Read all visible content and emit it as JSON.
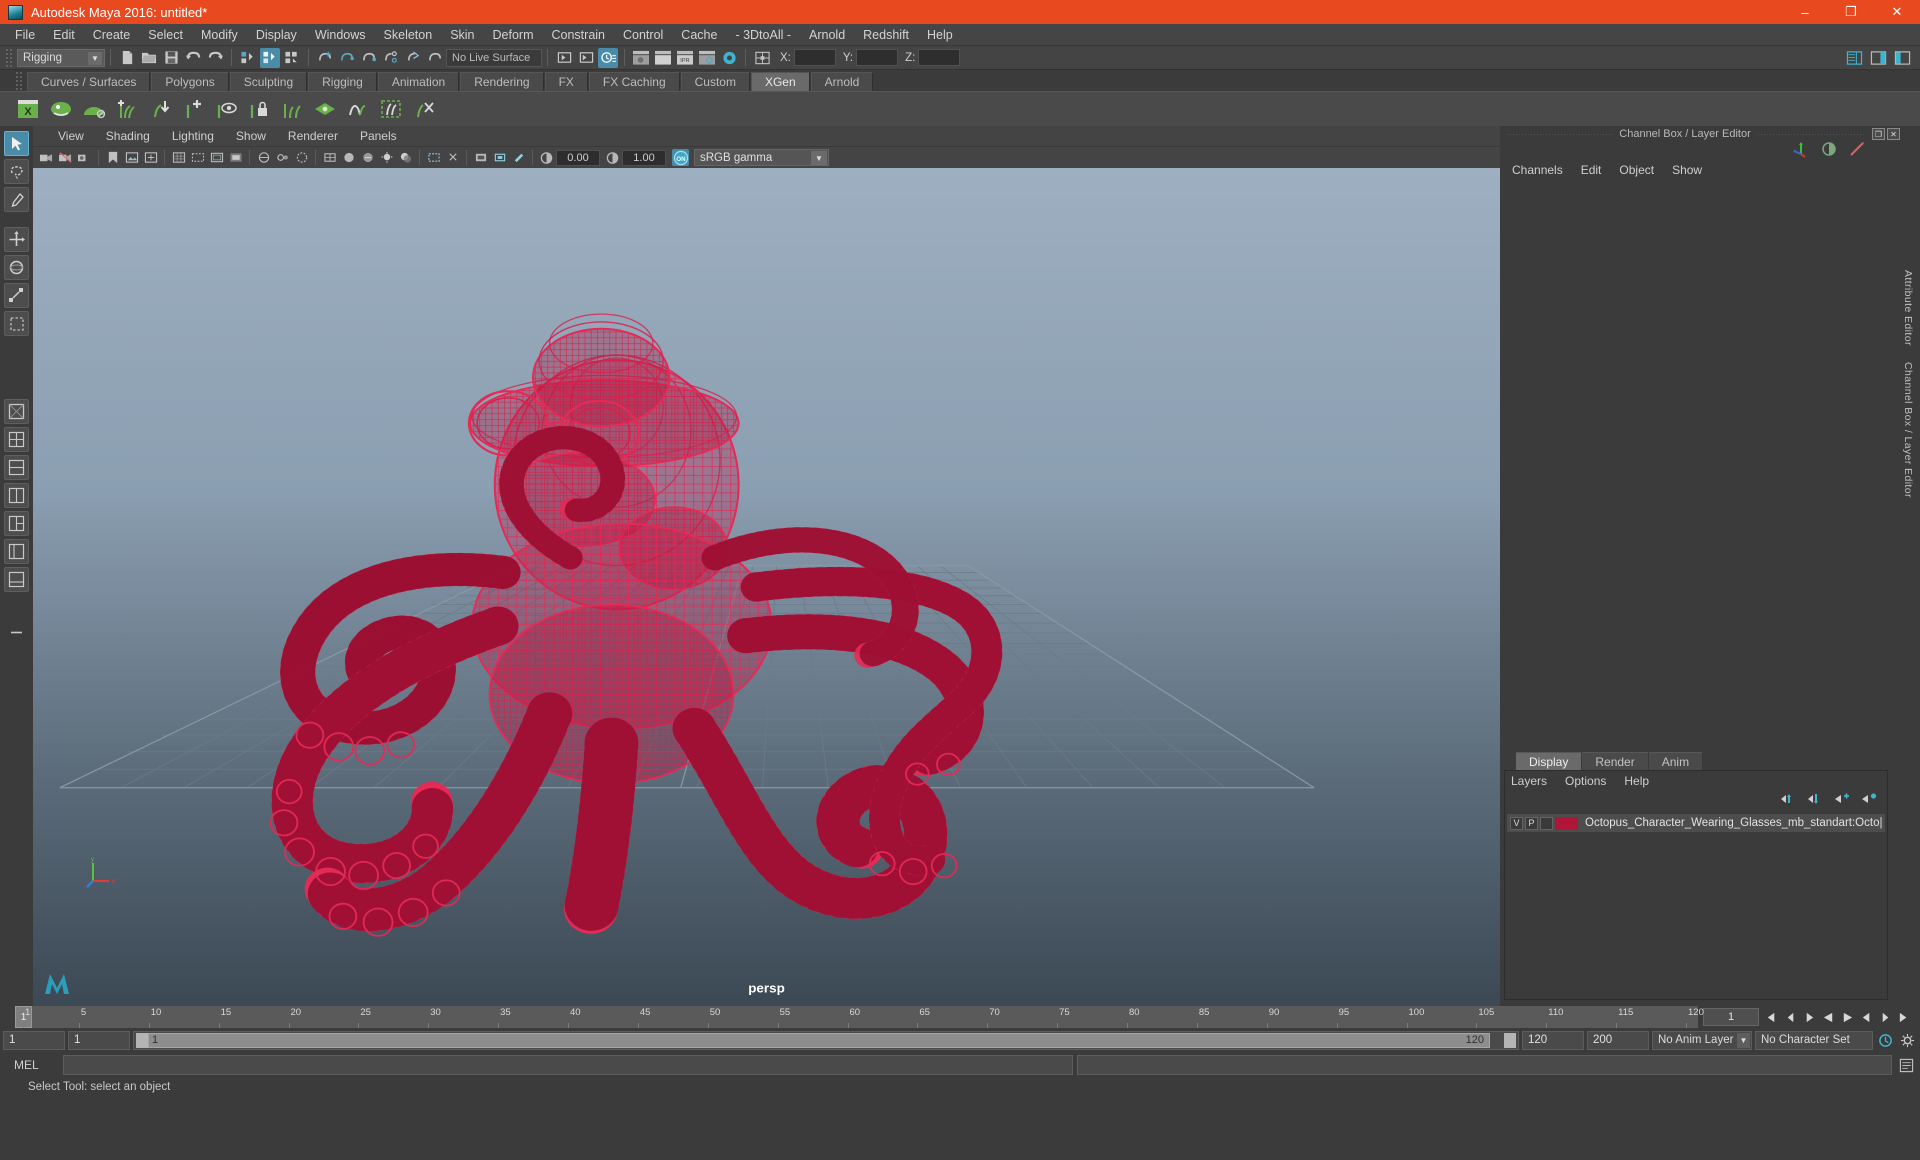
{
  "window": {
    "title": "Autodesk Maya 2016: untitled*",
    "minimize": "–",
    "maximize": "❐",
    "close": "✕"
  },
  "menubar": {
    "items": [
      {
        "label": "File"
      },
      {
        "label": "Edit"
      },
      {
        "label": "Create"
      },
      {
        "label": "Select"
      },
      {
        "label": "Modify"
      },
      {
        "label": "Display"
      },
      {
        "label": "Windows"
      },
      {
        "label": "Skeleton"
      },
      {
        "label": "Skin"
      },
      {
        "label": "Deform"
      },
      {
        "label": "Constrain"
      },
      {
        "label": "Control"
      },
      {
        "label": "Cache"
      },
      {
        "label": "- 3DtoAll -"
      },
      {
        "label": "Arnold"
      },
      {
        "label": "Redshift"
      },
      {
        "label": "Help"
      }
    ]
  },
  "statusbar": {
    "mode": "Rigging",
    "mode_arrow": "▼",
    "live_surface": "No Live Surface",
    "coord_x_label": "X:",
    "coord_y_label": "Y:",
    "coord_z_label": "Z:",
    "coord_x_value": "",
    "coord_y_value": "",
    "coord_z_value": "",
    "icons": [
      "new-scene-icon",
      "open-scene-icon",
      "save-scene-icon",
      "undo-icon",
      "redo-icon",
      "select-hierarchy-icon",
      "select-object-icon",
      "select-component-icon",
      "snap-grid-icon",
      "snap-curve-icon",
      "snap-point-icon",
      "snap-projected-icon",
      "snap-view-icon",
      "construction-history-icon",
      "render-sequence-icon",
      "render-view-icon",
      "render-current-icon",
      "ipr-render-icon",
      "render-settings-icon",
      "hypershade-icon",
      "editor-layout-icon"
    ]
  },
  "shelf": {
    "tabs": [
      {
        "label": "Curves / Surfaces",
        "selected": false
      },
      {
        "label": "Polygons",
        "selected": false
      },
      {
        "label": "Sculpting",
        "selected": false
      },
      {
        "label": "Rigging",
        "selected": false
      },
      {
        "label": "Animation",
        "selected": false
      },
      {
        "label": "Rendering",
        "selected": false
      },
      {
        "label": "FX",
        "selected": false
      },
      {
        "label": "FX Caching",
        "selected": false
      },
      {
        "label": "Custom",
        "selected": false
      },
      {
        "label": "XGen",
        "selected": true
      },
      {
        "label": "Arnold",
        "selected": false
      }
    ],
    "icons": [
      "xgen-editor-icon",
      "xgen-description-icon",
      "xgen-collection-icon",
      "add-guide-icon",
      "place-guide-icon",
      "add-clump-icon",
      "preview-visibility-icon",
      "lock-guide-icon",
      "comb-guides-icon",
      "density-map-icon",
      "clump-modifier-icon",
      "noise-modifier-icon",
      "cut-modifier-icon"
    ]
  },
  "toolbox": {
    "tools": [
      {
        "name": "select-tool",
        "selected": true
      },
      {
        "name": "lasso-select-tool",
        "selected": false
      },
      {
        "name": "paint-select-tool",
        "selected": false
      },
      {
        "name": "move-tool",
        "selected": false
      },
      {
        "name": "rotate-tool",
        "selected": false
      },
      {
        "name": "scale-tool",
        "selected": false
      },
      {
        "name": "last-tool-used",
        "selected": false
      }
    ],
    "layouts": [
      "single-perspective-layout",
      "four-view-layout",
      "two-pane-stacked-layout",
      "two-pane-side-layout",
      "three-pane-layout",
      "outliner-persp-layout",
      "hypershade-persp-layout",
      "more-layouts"
    ]
  },
  "viewport": {
    "panel_menu": [
      "View",
      "Shading",
      "Lighting",
      "Show",
      "Renderer",
      "Panels"
    ],
    "camera_label": "persp",
    "exposure": "0.00",
    "gamma": "1.00",
    "color_management": "sRGB gamma",
    "gamma_arrow": "▼",
    "cm_toggle_label": "ON",
    "toolbar_icons": [
      "select-camera-icon",
      "lock-camera-icon",
      "camera-attributes-icon",
      "bookmarks-icon",
      "image-plane-icon",
      "two-d-pan-zoom-icon",
      "grid-toggle-icon",
      "film-gate-icon",
      "resolution-gate-icon",
      "gate-mask-icon",
      "xray-icon",
      "xray-joints-icon",
      "wireframe-icon",
      "smooth-shade-icon",
      "smooth-shade-textured-icon",
      "lighting-icon",
      "shadows-icon",
      "ao-icon",
      "motion-blur-icon",
      "isolate-select-icon",
      "xray-active-icon"
    ],
    "model_name": "Octopus wireframe model",
    "model_color": "#c4123f",
    "bg_top_color": "#9aadbe",
    "bg_bottom_color": "#3e4b57"
  },
  "channelbox": {
    "panel_title": "Channel Box / Layer Editor",
    "restore_icon": "❐",
    "close_icon": "✕",
    "menus": [
      "Channels",
      "Edit",
      "Object",
      "Show"
    ],
    "header_icons": [
      "transform-attributes-icon",
      "render-attributes-icon",
      "anim-attributes-icon"
    ]
  },
  "attribute_editor": {
    "vertical_tabs": [
      "Attribute Editor",
      "Channel Box / Layer Editor"
    ]
  },
  "layer_editor": {
    "tabs": [
      {
        "label": "Display",
        "selected": true
      },
      {
        "label": "Render",
        "selected": false
      },
      {
        "label": "Anim",
        "selected": false
      }
    ],
    "menus": [
      "Layers",
      "Options",
      "Help"
    ],
    "buttons": [
      "move-layer-up-icon",
      "move-layer-down-icon",
      "new-layer-icon",
      "new-layer-from-selected-icon"
    ],
    "layers": [
      {
        "visibility": "V",
        "playback": "P",
        "state": "",
        "color": "#b01437",
        "name": "Octopus_Character_Wearing_Glasses_mb_standart:Octo|"
      }
    ]
  },
  "timeslider": {
    "current_frame": "1",
    "frame_field": "1",
    "ticks": [
      {
        "label": "1",
        "pos": 0
      },
      {
        "label": "5",
        "pos": 4
      },
      {
        "label": "10",
        "pos": 9
      },
      {
        "label": "15",
        "pos": 14
      },
      {
        "label": "20",
        "pos": 19
      },
      {
        "label": "25",
        "pos": 24
      },
      {
        "label": "30",
        "pos": 29
      },
      {
        "label": "35",
        "pos": 34
      },
      {
        "label": "40",
        "pos": 39
      },
      {
        "label": "45",
        "pos": 44
      },
      {
        "label": "50",
        "pos": 49
      },
      {
        "label": "55",
        "pos": 54
      },
      {
        "label": "60",
        "pos": 59
      },
      {
        "label": "65",
        "pos": 64
      },
      {
        "label": "70",
        "pos": 69
      },
      {
        "label": "75",
        "pos": 74
      },
      {
        "label": "80",
        "pos": 79
      },
      {
        "label": "85",
        "pos": 84
      },
      {
        "label": "90",
        "pos": 89
      },
      {
        "label": "95",
        "pos": 94
      },
      {
        "label": "100",
        "pos": 99
      },
      {
        "label": "105",
        "pos": 104
      },
      {
        "label": "110",
        "pos": 109
      },
      {
        "label": "115",
        "pos": 114
      },
      {
        "label": "120",
        "pos": 119
      }
    ],
    "playback_buttons": [
      "go-to-start-icon",
      "step-back-keyframe-icon",
      "step-back-frame-icon",
      "play-backwards-icon",
      "play-forwards-icon",
      "step-forward-frame-icon",
      "step-forward-keyframe-icon",
      "go-to-end-icon"
    ]
  },
  "rangeslider": {
    "anim_start": "1",
    "range_start": "1",
    "slider_start_label": "1",
    "slider_end_label": "120",
    "range_end": "120",
    "anim_end": "200",
    "anim_layer": "No Anim Layer",
    "character_set": "No Character Set",
    "anim_layer_arrow": "▼",
    "char_set_arrow": "▼",
    "auto_key_icon": "auto-keyframe-icon",
    "prefs_icon": "animation-preferences-icon"
  },
  "commandline": {
    "language": "MEL",
    "input_value": "",
    "output_value": "",
    "script_editor_icon": "script-editor-icon"
  },
  "helpline": {
    "text": "Select Tool: select an object"
  }
}
